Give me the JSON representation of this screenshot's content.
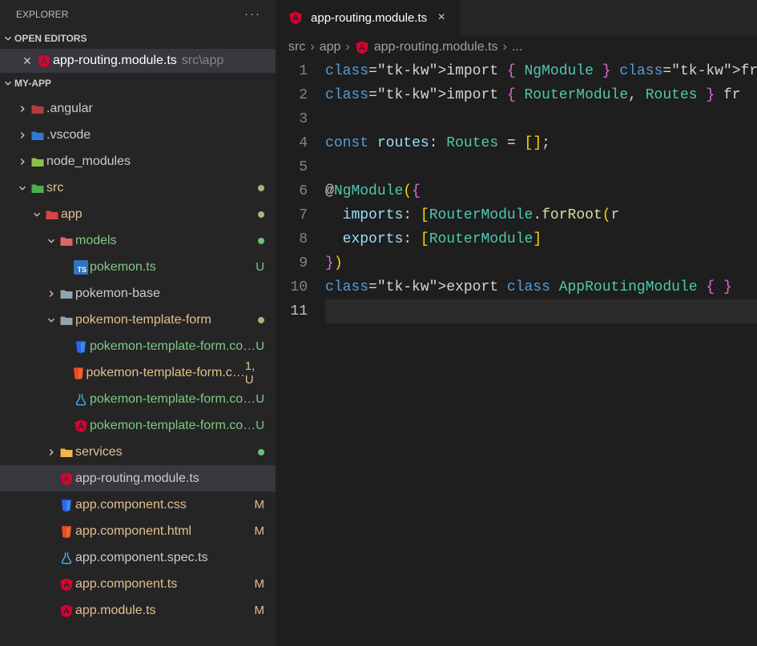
{
  "explorer": {
    "title": "EXPLORER"
  },
  "openEditors": {
    "label": "OPEN EDITORS",
    "items": [
      {
        "file": "app-routing.module.ts",
        "path": "src\\app",
        "icon": "angular"
      }
    ]
  },
  "workspace": {
    "name": "MY-APP",
    "tree": [
      {
        "depth": 0,
        "chev": "right",
        "icon": "folder-angular",
        "label": ".angular",
        "status": ""
      },
      {
        "depth": 0,
        "chev": "right",
        "icon": "folder-vscode",
        "label": ".vscode",
        "status": ""
      },
      {
        "depth": 0,
        "chev": "right",
        "icon": "folder-node",
        "label": "node_modules",
        "status": ""
      },
      {
        "depth": 0,
        "chev": "down",
        "icon": "folder-src",
        "label": "src",
        "status": "dot-olive",
        "color": "amber"
      },
      {
        "depth": 1,
        "chev": "down",
        "icon": "folder-app",
        "label": "app",
        "status": "dot-olive",
        "color": "amber"
      },
      {
        "depth": 2,
        "chev": "down",
        "icon": "folder-models",
        "label": "models",
        "status": "dot-green",
        "color": "green"
      },
      {
        "depth": 3,
        "chev": "",
        "icon": "ts",
        "label": "pokemon.ts",
        "status": "U",
        "color": "green"
      },
      {
        "depth": 2,
        "chev": "right",
        "icon": "folder-plain",
        "label": "pokemon-base",
        "status": ""
      },
      {
        "depth": 2,
        "chev": "down",
        "icon": "folder-plain",
        "label": "pokemon-template-form",
        "status": "dot-olive",
        "color": "amber"
      },
      {
        "depth": 3,
        "chev": "",
        "icon": "css",
        "label": "pokemon-template-form.co…",
        "status": "U",
        "color": "green"
      },
      {
        "depth": 3,
        "chev": "",
        "icon": "html",
        "label": "pokemon-template-form.c…",
        "status": "1, U",
        "color": "amber"
      },
      {
        "depth": 3,
        "chev": "",
        "icon": "flask",
        "label": "pokemon-template-form.co…",
        "status": "U",
        "color": "green"
      },
      {
        "depth": 3,
        "chev": "",
        "icon": "angular",
        "label": "pokemon-template-form.co…",
        "status": "U",
        "color": "green"
      },
      {
        "depth": 2,
        "chev": "right",
        "icon": "folder-services",
        "label": "services",
        "status": "dot-green",
        "color": "amber"
      },
      {
        "depth": 2,
        "chev": "",
        "icon": "angular",
        "label": "app-routing.module.ts",
        "status": "",
        "selected": true
      },
      {
        "depth": 2,
        "chev": "",
        "icon": "css",
        "label": "app.component.css",
        "status": "M",
        "color": "amber"
      },
      {
        "depth": 2,
        "chev": "",
        "icon": "html",
        "label": "app.component.html",
        "status": "M",
        "color": "amber"
      },
      {
        "depth": 2,
        "chev": "",
        "icon": "flask",
        "label": "app.component.spec.ts",
        "status": ""
      },
      {
        "depth": 2,
        "chev": "",
        "icon": "angular",
        "label": "app.component.ts",
        "status": "M",
        "color": "amber"
      },
      {
        "depth": 2,
        "chev": "",
        "icon": "angular",
        "label": "app.module.ts",
        "status": "M",
        "color": "amber"
      }
    ]
  },
  "tab": {
    "file": "app-routing.module.ts"
  },
  "breadcrumb": {
    "parts": [
      "src",
      "app",
      "app-routing.module.ts",
      "..."
    ]
  },
  "code": {
    "lines": [
      "import { NgModule } from '@angular",
      "import { RouterModule, Routes } fr",
      "",
      "const routes: Routes = [];",
      "",
      "@NgModule({",
      "  imports: [RouterModule.forRoot(r",
      "  exports: [RouterModule]",
      "})",
      "export class AppRoutingModule { }",
      ""
    ]
  }
}
